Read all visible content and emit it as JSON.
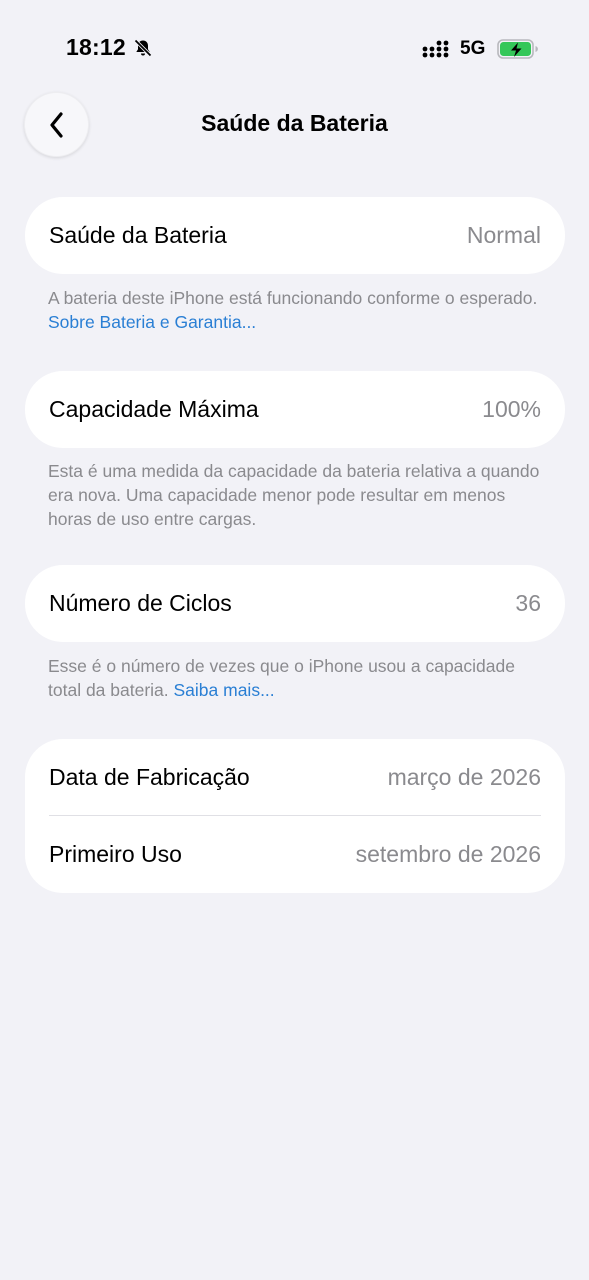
{
  "status_bar": {
    "time": "18:12",
    "network": "5G"
  },
  "nav": {
    "title": "Saúde da Bateria"
  },
  "sections": {
    "health": {
      "label": "Saúde da Bateria",
      "value": "Normal",
      "footnote_text": "A bateria deste iPhone está funcionando conforme o esperado. ",
      "footnote_link": "Sobre Bateria e Garantia..."
    },
    "capacity": {
      "label": "Capacidade Máxima",
      "value": "100%",
      "footnote_text": "Esta é uma medida da capacidade da bateria relativa a quando era nova. Uma capacidade menor pode resultar em menos horas de uso entre cargas."
    },
    "cycles": {
      "label": "Número de Ciclos",
      "value": "36",
      "footnote_text": "Esse é o número de vezes que o iPhone usou a capacidade total da bateria. ",
      "footnote_link": "Saiba mais..."
    },
    "dates": {
      "manufacture_label": "Data de Fabricação",
      "manufacture_value": "março de 2026",
      "first_use_label": "Primeiro Uso",
      "first_use_value": "setembro de 2026"
    }
  },
  "colors": {
    "background": "#f2f2f7",
    "link": "#2a7fd4",
    "secondary_text": "#8a8a8e",
    "battery_charging": "#34c759"
  },
  "icons": {
    "silent": "bell-slash-icon",
    "signal": "cellular-signal-icon",
    "battery": "battery-charging-icon",
    "back": "chevron-left-icon"
  }
}
